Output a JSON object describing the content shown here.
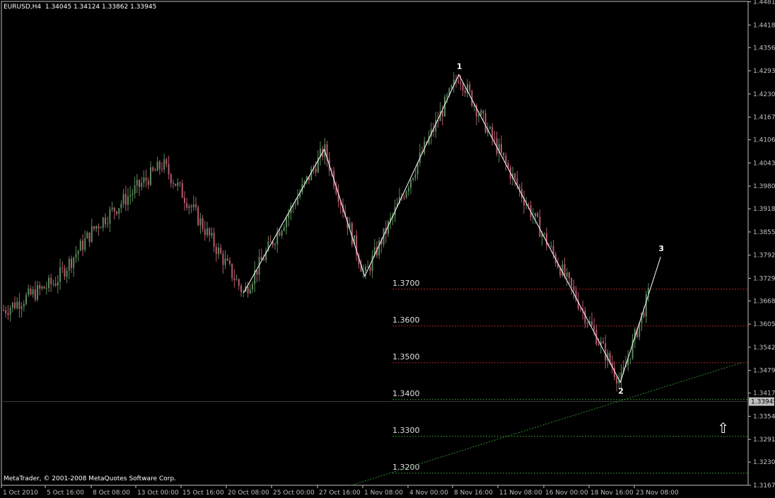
{
  "header": {
    "symbol": "EURUSD,H4",
    "ohlc": "1.34045 1.34124 1.33862 1.33945"
  },
  "copyright": "MetaTrader, © 2001-2008 MetaQuotes Software Corp.",
  "colors": {
    "background": "#000000",
    "axis": "#c0c0c0",
    "bull_candle": "#5a8a5a",
    "bear_candle": "#b45a6e",
    "wave_line": "#ffffff",
    "resistance_level": "#b22222",
    "support_level": "#2e8b2e",
    "trendline": "#2e8b2e",
    "price_marker_bg": "#c0c0c0"
  },
  "chart_data": {
    "type": "candlestick",
    "symbol": "EURUSD",
    "timeframe": "H4",
    "ylim": [
      1.3167,
      1.4482
    ],
    "y_ticks": [
      "1.44810",
      "1.44180",
      "1.43565",
      "1.42935",
      "1.42305",
      "1.41675",
      "1.41060",
      "1.40430",
      "1.39800",
      "1.39185",
      "1.38555",
      "1.37925",
      "1.37295",
      "1.36680",
      "1.36050",
      "1.35420",
      "1.34790",
      "1.34175",
      "1.33945",
      "1.33545",
      "1.32915",
      "1.32300",
      "1.31670"
    ],
    "current_price": "1.33945",
    "x_ticks": [
      "1 Oct 2010",
      "5 Oct 16:00",
      "8 Oct 08:00",
      "13 Oct 00:00",
      "15 Oct 16:00",
      "20 Oct 08:00",
      "25 Oct 00:00",
      "27 Oct 16:00",
      "1 Nov 08:00",
      "4 Nov 00:00",
      "8 Nov 16:00",
      "11 Nov 08:00",
      "16 Nov 00:00",
      "18 Nov 16:00",
      "23 Nov 08:00"
    ],
    "wave_points": [
      {
        "label": "",
        "x": "19 Oct 2010",
        "y": 1.369
      },
      {
        "label": "",
        "x": "25 Oct 2010",
        "y": 1.408
      },
      {
        "label": "",
        "x": "28 Oct 2010",
        "y": 1.3735
      },
      {
        "label": "1",
        "x": "4 Nov 2010",
        "y": 1.4283
      },
      {
        "label": "2",
        "x": "16 Nov 2010",
        "y": 1.3447
      },
      {
        "label": "3",
        "x": "19 Nov 2010",
        "y": 1.3788
      }
    ],
    "levels": [
      {
        "label": "1.3700",
        "value": 1.37,
        "kind": "resistance"
      },
      {
        "label": "1.3600",
        "value": 1.36,
        "kind": "resistance"
      },
      {
        "label": "1.3500",
        "value": 1.35,
        "kind": "resistance"
      },
      {
        "label": "1.3400",
        "value": 1.34,
        "kind": "support"
      },
      {
        "label": "1.3300",
        "value": 1.33,
        "kind": "support"
      },
      {
        "label": "1.3200",
        "value": 1.32,
        "kind": "support"
      }
    ],
    "trendline": {
      "from": {
        "x": "27 Oct 2010",
        "y": 1.3167
      },
      "to": {
        "x": "25 Nov 2010",
        "y": 1.35
      }
    },
    "signal": {
      "symbol": "⇧",
      "x": "23 Nov 2010"
    }
  }
}
